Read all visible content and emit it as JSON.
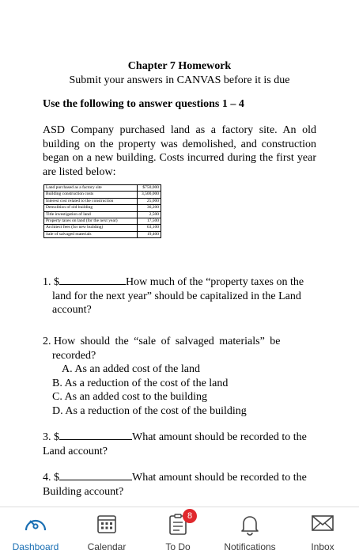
{
  "document": {
    "title": "Chapter 7 Homework",
    "subtitle": "Submit your answers in CANVAS before it is due",
    "instruction": "Use the following to answer questions 1 – 4",
    "paragraph": "ASD Company purchased land as a factory site. An old building on the property was demolished, and construction began on a new building. Costs incurred during the first year are listed below:",
    "cost_table": [
      {
        "label": "Land purchased as a factory site",
        "amount": "$750,000"
      },
      {
        "label": "Building construction costs",
        "amount": "3,500,000"
      },
      {
        "label": "Interest cost related to the construction",
        "amount": "25,000"
      },
      {
        "label": "Demolition of old building",
        "amount": "36,200"
      },
      {
        "label": "Title investigation of land",
        "amount": "2,500"
      },
      {
        "label": "Property taxes on land (for the next year)",
        "amount": "17,500"
      },
      {
        "label": "Architect fees (for new building)",
        "amount": "63,100"
      },
      {
        "label": "Sale of salvaged materials",
        "amount": "19,400"
      }
    ],
    "q1": {
      "number": "1.",
      "dollar": "$",
      "text_a": "How much of the “property taxes on the",
      "text_b": "land for the next year” should be capitalized in the Land",
      "text_c": "account?"
    },
    "q2": {
      "number": "2.",
      "text_a": "How should the “sale of salvaged materials” be",
      "text_b": "recorded?",
      "options": [
        "A. As an added cost of the land",
        "B. As a reduction of the cost of the land",
        "C. As an added cost to the building",
        "D. As a reduction of the cost of the building"
      ]
    },
    "q3": {
      "number": "3.",
      "dollar": "$",
      "text_a": "What amount should be recorded to the",
      "text_b": "Land account?"
    },
    "q4": {
      "number": "4.",
      "dollar": "$",
      "text_a": "What amount should be recorded to the",
      "text_b": "Building account?"
    }
  },
  "navbar": {
    "accent_color": "#1a6fb3",
    "badge_color": "#e0282d",
    "items": [
      {
        "label": "Dashboard",
        "icon": "dashboard-icon"
      },
      {
        "label": "Calendar",
        "icon": "calendar-icon"
      },
      {
        "label": "To Do",
        "icon": "todo-icon",
        "badge": "8"
      },
      {
        "label": "Notifications",
        "icon": "bell-icon"
      },
      {
        "label": "Inbox",
        "icon": "mail-icon"
      }
    ]
  }
}
